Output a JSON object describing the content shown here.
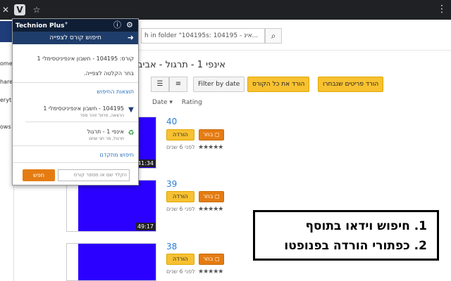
{
  "browser": {
    "close_glyph": "✕",
    "star_glyph": "☆",
    "menu_glyph": "⋮"
  },
  "sidebar": {
    "items": [
      "ome",
      "hared",
      "eryt",
      "ows"
    ]
  },
  "search": {
    "value": "h in folder \"104195s: 104195 - אינ..."
  },
  "folder": {
    "title": "אינפי 1 - תרגול - אביב ..."
  },
  "toolbar": {
    "filter_label": "Filter by date",
    "download_course_label": "הורד את כל הקורס",
    "download_selected_label": "הורד פריטים שנבחרו"
  },
  "sort": {
    "date_label": "Date ▾",
    "rating_label": "Rating"
  },
  "videos": [
    {
      "number": "40",
      "duration": "41:34",
      "select_label": "בחר",
      "download_label": "הורדה",
      "stars": "★★★★★",
      "ago": "לפני 6 שנים"
    },
    {
      "number": "39",
      "duration": "49:17",
      "select_label": "בחר",
      "download_label": "הורדה",
      "stars": "★★★★★",
      "ago": "לפני 6 שנים"
    },
    {
      "number": "38",
      "duration": "",
      "select_label": "בחר",
      "download_label": "הורדה",
      "stars": "★★★★★",
      "ago": "לפני 6 שנים"
    }
  ],
  "popup": {
    "title": "Technion Plus",
    "title_sup": "+",
    "info_glyph": "ⓘ",
    "gear_glyph": "⚙",
    "search_bar_label": "חיפוש קורס לצפייה",
    "arrow_glyph": "➜",
    "course_line": "קורס: 104195 - חשבון אינפיניטסימלי 1",
    "choose_line": "בחר הקלטה לצפייה.",
    "results_heading": "תוצאות החיפוש",
    "results": [
      {
        "title": "104195 - חשבון אינפיניטסימלי 1",
        "sub": "הרצאה, פרופ' זוהר ספר",
        "icon": "▼"
      },
      {
        "title": "אינפי 1 - תרגול",
        "sub": "תרגול, מר חגי שחם",
        "icon": "♻"
      }
    ],
    "advanced_link": "חיפוש מתקדם",
    "input_placeholder": "הקלד שם או מספר קורס",
    "search_button": "חפש"
  },
  "annotation": {
    "line1": "1. חיפוש וידאו בתוסף",
    "line2": "2. כפתורי הורדה בפנופטו"
  },
  "colors": {
    "popup_header": "#0f1e35",
    "accent_orange": "#e57c12",
    "accent_yellow": "#f7c131",
    "video_blue": "#2b00ff"
  }
}
